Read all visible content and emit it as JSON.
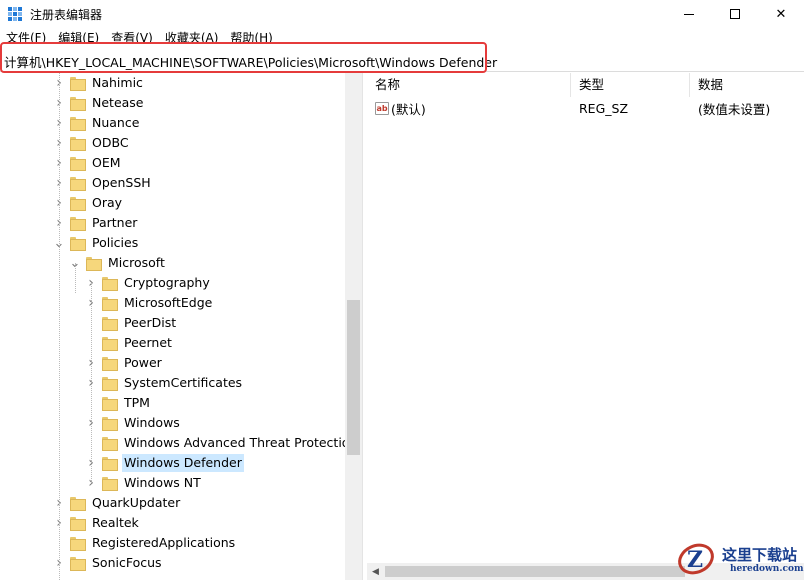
{
  "window": {
    "title": "注册表编辑器",
    "controls": {
      "close": "✕"
    }
  },
  "menu": [
    "文件(F)",
    "编辑(E)",
    "查看(V)",
    "收藏夹(A)",
    "帮助(H)"
  ],
  "address": {
    "path": "计算机\\HKEY_LOCAL_MACHINE\\SOFTWARE\\Policies\\Microsoft\\Windows Defender",
    "highlight_color": "#e53b3b"
  },
  "tree": {
    "items": [
      {
        "label": "Nahimic",
        "level": 0,
        "expander": "collapsed"
      },
      {
        "label": "Netease",
        "level": 0,
        "expander": "collapsed"
      },
      {
        "label": "Nuance",
        "level": 0,
        "expander": "collapsed"
      },
      {
        "label": "ODBC",
        "level": 0,
        "expander": "collapsed"
      },
      {
        "label": "OEM",
        "level": 0,
        "expander": "collapsed"
      },
      {
        "label": "OpenSSH",
        "level": 0,
        "expander": "collapsed"
      },
      {
        "label": "Oray",
        "level": 0,
        "expander": "collapsed"
      },
      {
        "label": "Partner",
        "level": 0,
        "expander": "collapsed"
      },
      {
        "label": "Policies",
        "level": 0,
        "expander": "expanded"
      },
      {
        "label": "Microsoft",
        "level": 1,
        "expander": "expanded"
      },
      {
        "label": "Cryptography",
        "level": 2,
        "expander": "collapsed"
      },
      {
        "label": "MicrosoftEdge",
        "level": 2,
        "expander": "collapsed"
      },
      {
        "label": "PeerDist",
        "level": 2,
        "expander": "none"
      },
      {
        "label": "Peernet",
        "level": 2,
        "expander": "none"
      },
      {
        "label": "Power",
        "level": 2,
        "expander": "collapsed"
      },
      {
        "label": "SystemCertificates",
        "level": 2,
        "expander": "collapsed"
      },
      {
        "label": "TPM",
        "level": 2,
        "expander": "none"
      },
      {
        "label": "Windows",
        "level": 2,
        "expander": "collapsed"
      },
      {
        "label": "Windows Advanced Threat Protection",
        "level": 2,
        "expander": "none"
      },
      {
        "label": "Windows Defender",
        "level": 2,
        "expander": "collapsed",
        "selected": true
      },
      {
        "label": "Windows NT",
        "level": 2,
        "expander": "collapsed"
      },
      {
        "label": "QuarkUpdater",
        "level": 0,
        "expander": "collapsed"
      },
      {
        "label": "Realtek",
        "level": 0,
        "expander": "collapsed"
      },
      {
        "label": "RegisteredApplications",
        "level": 0,
        "expander": "none"
      },
      {
        "label": "SonicFocus",
        "level": 0,
        "expander": "collapsed"
      }
    ]
  },
  "values": {
    "columns": [
      "名称",
      "类型",
      "数据"
    ],
    "rows": [
      {
        "name": "(默认)",
        "type": "REG_SZ",
        "data": "(数值未设置)",
        "icon": "ab"
      }
    ]
  },
  "watermark": {
    "main": "这里下载站",
    "sub": "heredown.com",
    "logo_letter": "Z"
  },
  "colors": {
    "selection": "#cce8ff",
    "folder": "#f6d77c",
    "accent": "#1e78d6"
  }
}
